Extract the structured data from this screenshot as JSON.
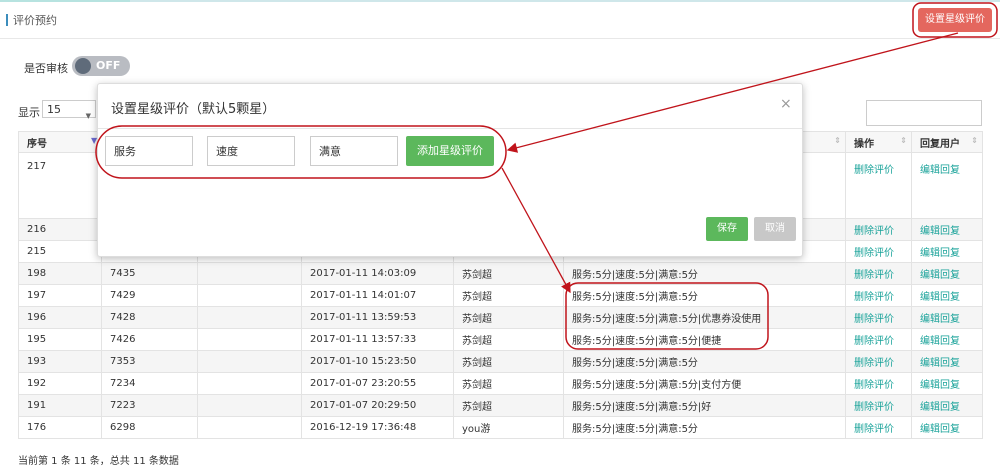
{
  "header": {
    "title": "评价预约",
    "rate_button": "设置星级评价"
  },
  "filters": {
    "audit_label": "是否审核",
    "toggle_text": "OFF",
    "show_label": "显示",
    "show_value": "15"
  },
  "table": {
    "headers": {
      "id": "序号",
      "actions": "操作",
      "reply_user": "回复用户"
    },
    "rows": [
      {
        "id": "217",
        "num": "",
        "time": "",
        "name": "",
        "content": "",
        "del": "删除评价",
        "edit": "编辑回复"
      },
      {
        "id": "216",
        "num": "",
        "time": "",
        "name": "",
        "content": "",
        "del": "删除评价",
        "edit": "编辑回复"
      },
      {
        "id": "215",
        "num": "",
        "time": "",
        "name": "",
        "content": "",
        "del": "删除评价",
        "edit": "编辑回复"
      },
      {
        "id": "198",
        "num": "7435",
        "time": "2017-01-11 14:03:09",
        "name": "苏剑超",
        "content": "服务:5分|速度:5分|满意:5分",
        "del": "删除评价",
        "edit": "编辑回复"
      },
      {
        "id": "197",
        "num": "7429",
        "time": "2017-01-11 14:01:07",
        "name": "苏剑超",
        "content": "服务:5分|速度:5分|满意:5分",
        "del": "删除评价",
        "edit": "编辑回复"
      },
      {
        "id": "196",
        "num": "7428",
        "time": "2017-01-11 13:59:53",
        "name": "苏剑超",
        "content": "服务:5分|速度:5分|满意:5分|优惠券没使用",
        "del": "删除评价",
        "edit": "编辑回复"
      },
      {
        "id": "195",
        "num": "7426",
        "time": "2017-01-11 13:57:33",
        "name": "苏剑超",
        "content": "服务:5分|速度:5分|满意:5分|便捷",
        "del": "删除评价",
        "edit": "编辑回复"
      },
      {
        "id": "193",
        "num": "7353",
        "time": "2017-01-10 15:23:50",
        "name": "苏剑超",
        "content": "服务:5分|速度:5分|满意:5分",
        "del": "删除评价",
        "edit": "编辑回复"
      },
      {
        "id": "192",
        "num": "7234",
        "time": "2017-01-07 23:20:55",
        "name": "苏剑超",
        "content": "服务:5分|速度:5分|满意:5分|支付方便",
        "del": "删除评价",
        "edit": "编辑回复"
      },
      {
        "id": "191",
        "num": "7223",
        "time": "2017-01-07 20:29:50",
        "name": "苏剑超",
        "content": "服务:5分|速度:5分|满意:5分|好",
        "del": "删除评价",
        "edit": "编辑回复"
      },
      {
        "id": "176",
        "num": "6298",
        "time": "2016-12-19 17:36:48",
        "name": "you游",
        "content": "服务:5分|速度:5分|满意:5分",
        "del": "删除评价",
        "edit": "编辑回复"
      }
    ]
  },
  "footer": {
    "text": "当前第 1 条 11 条，总共 11 条数据"
  },
  "modal": {
    "title": "设置星级评价（默认5颗星）",
    "close": "×",
    "fields": [
      "服务",
      "速度",
      "满意"
    ],
    "add_button": "添加星级评价",
    "save": "保存",
    "cancel": "取消"
  },
  "colors": {
    "accent_red": "#e4675e",
    "green": "#5cb85c",
    "link_teal": "#1aa39a",
    "annotation_red": "#c0141b"
  }
}
